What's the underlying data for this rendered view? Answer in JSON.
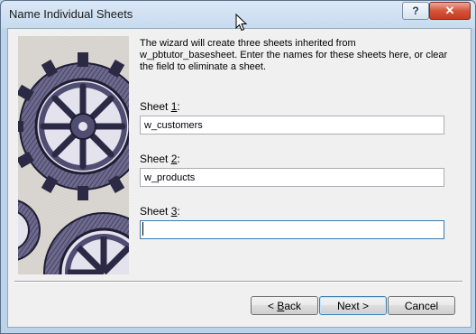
{
  "window": {
    "title": "Name Individual Sheets",
    "help_label": "?",
    "close_label": "✕"
  },
  "intro_text": "The wizard will create three sheets inherited from w_pbtutor_basesheet.  Enter the names for these sheets here, or clear the field to eliminate a sheet.",
  "sheets": [
    {
      "label_prefix": "Sheet ",
      "label_key": "1",
      "label_suffix": ":",
      "value": "w_customers"
    },
    {
      "label_prefix": "Sheet ",
      "label_key": "2",
      "label_suffix": ":",
      "value": "w_products"
    },
    {
      "label_prefix": "Sheet ",
      "label_key": "3",
      "label_suffix": ":",
      "value": ""
    }
  ],
  "buttons": {
    "back": {
      "prefix": "< ",
      "key": "B",
      "rest": "ack"
    },
    "next": "Next >",
    "cancel": "Cancel"
  },
  "icons": {
    "banner": "gears-illustration",
    "cursor": "mouse-pointer-icon"
  }
}
